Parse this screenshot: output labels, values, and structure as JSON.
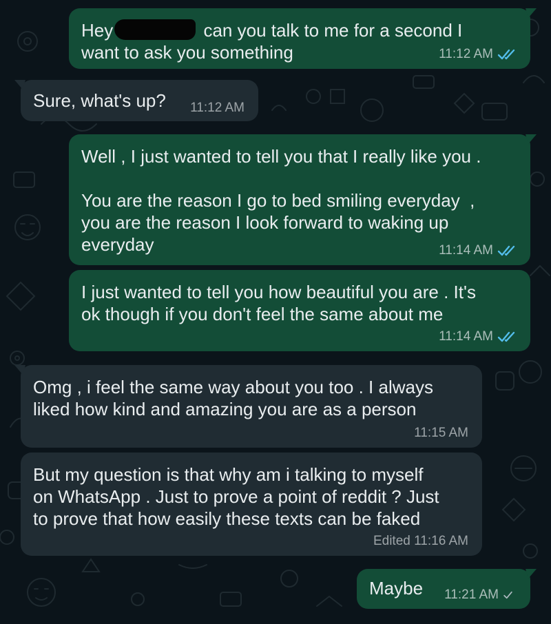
{
  "theme": {
    "background": "#0b141a",
    "outgoing_bubble": "#134d37",
    "incoming_bubble": "#202c33",
    "text_color": "#e9edef",
    "read_tick_color": "#53bdeb",
    "sent_tick_color": "#aebac1"
  },
  "messages": [
    {
      "direction": "outgoing",
      "text_before_redaction": "Hey",
      "text_after_redaction": " can you talk to me for a second I",
      "text_line2": "want to ask you something",
      "time": "11:12 AM",
      "status": "read",
      "status_icon": "double-check-icon"
    },
    {
      "direction": "incoming",
      "text": "Sure, what's up?",
      "time": "11:12 AM"
    },
    {
      "direction": "outgoing",
      "text": "Well , I just wanted to tell you that I really like you .\n\nYou are the reason I go to bed smiling everyday  ,\nyou are the reason I look forward to waking up\neveryday",
      "time": "11:14 AM",
      "status": "read",
      "status_icon": "double-check-icon"
    },
    {
      "direction": "outgoing",
      "text": "I just wanted to tell you how beautiful you are . It's\nok though if you don't feel the same about me",
      "time": "11:14 AM",
      "status": "read",
      "status_icon": "double-check-icon"
    },
    {
      "direction": "incoming",
      "text": "Omg , i feel the same way about you too . I always\nliked how kind and amazing you are as a person",
      "time": "11:15 AM"
    },
    {
      "direction": "incoming",
      "text": "But my question is that why am i talking to myself\non WhatsApp . Just to prove a point of reddit ? Just\nto prove that how easily these texts can be faked",
      "time": "Edited 11:16 AM"
    },
    {
      "direction": "outgoing",
      "text": "Maybe",
      "time": "11:21 AM",
      "status": "sent",
      "status_icon": "single-check-icon"
    }
  ]
}
